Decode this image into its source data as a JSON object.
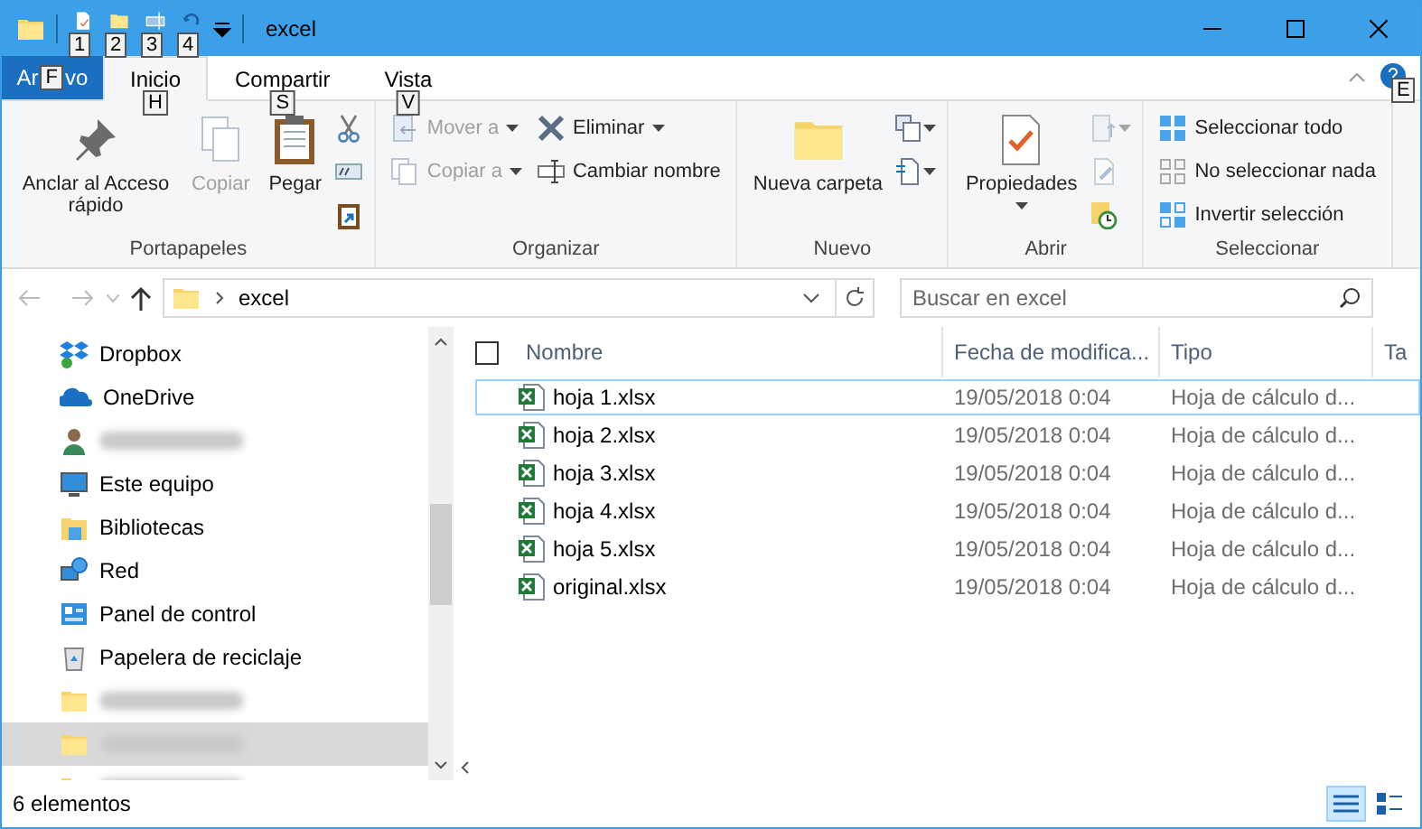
{
  "window": {
    "title": "excel"
  },
  "quick_access": [
    {
      "keytip": "1"
    },
    {
      "keytip": "2"
    },
    {
      "keytip": "3"
    },
    {
      "keytip": "4"
    }
  ],
  "ribbon_tabs": [
    {
      "kind": "file",
      "label_parts": [
        "Ar",
        "vo"
      ],
      "keytip": "F",
      "selected": false
    },
    {
      "kind": "tab",
      "label": "Inicio",
      "keytip": "H",
      "selected": true
    },
    {
      "kind": "tab",
      "label": "Compartir",
      "keytip": "S",
      "selected": false
    },
    {
      "kind": "tab",
      "label": "Vista",
      "keytip": "V",
      "selected": false
    }
  ],
  "help_keytip": "E",
  "ribbon_groups": [
    {
      "label": "Portapapeles",
      "columns": [
        [
          {
            "kind": "large",
            "label": "Anclar al Acceso rápido",
            "disabled": false
          }
        ],
        [
          {
            "kind": "large",
            "label": "Copiar",
            "disabled": true
          }
        ],
        [
          {
            "kind": "large",
            "label": "Pegar",
            "disabled": false
          }
        ],
        [
          {
            "kind": "icon",
            "disabled": false
          },
          {
            "kind": "icon",
            "disabled": false
          },
          {
            "kind": "icon",
            "disabled": false
          }
        ]
      ]
    },
    {
      "label": "Organizar",
      "columns": [
        [
          {
            "kind": "small",
            "label": "Mover a",
            "dropdown": true,
            "disabled": true
          },
          {
            "kind": "small",
            "label": "Copiar a",
            "dropdown": true,
            "disabled": true
          }
        ],
        [
          {
            "kind": "small",
            "label": "Eliminar",
            "dropdown": true,
            "disabled": false
          },
          {
            "kind": "small",
            "label": "Cambiar nombre",
            "dropdown": false,
            "disabled": false
          }
        ]
      ]
    },
    {
      "label": "Nuevo",
      "columns": [
        [
          {
            "kind": "large",
            "label": "Nueva carpeta",
            "disabled": false
          }
        ],
        [
          {
            "kind": "icon",
            "dropdown": true,
            "disabled": false
          },
          {
            "kind": "icon",
            "dropdown": true,
            "disabled": false
          }
        ]
      ]
    },
    {
      "label": "Abrir",
      "columns": [
        [
          {
            "kind": "large",
            "label": "Propiedades",
            "dropdown": true,
            "disabled": false
          }
        ],
        [
          {
            "kind": "icon",
            "dropdown": true,
            "disabled": true
          },
          {
            "kind": "icon",
            "disabled": true
          },
          {
            "kind": "icon",
            "disabled": false
          }
        ]
      ]
    },
    {
      "label": "Seleccionar",
      "columns": [
        [
          {
            "kind": "small",
            "label": "Seleccionar todo",
            "disabled": false
          },
          {
            "kind": "small",
            "label": "No seleccionar nada",
            "disabled": false
          },
          {
            "kind": "small",
            "label": "Invertir selección",
            "disabled": false
          }
        ]
      ]
    }
  ],
  "address": {
    "path": "excel"
  },
  "search": {
    "placeholder": "Buscar en excel"
  },
  "nav_items": [
    {
      "kind": "dropbox",
      "label": "Dropbox",
      "selected": false
    },
    {
      "kind": "onedrive",
      "label": "OneDrive",
      "selected": false
    },
    {
      "kind": "user",
      "blurred": true,
      "selected": false
    },
    {
      "kind": "pc",
      "label": "Este equipo",
      "selected": false
    },
    {
      "kind": "libraries",
      "label": "Bibliotecas",
      "selected": false
    },
    {
      "kind": "network",
      "label": "Red",
      "selected": false
    },
    {
      "kind": "control",
      "label": "Panel de control",
      "selected": false
    },
    {
      "kind": "recycle",
      "label": "Papelera de reciclaje",
      "selected": false
    },
    {
      "kind": "folder",
      "blurred": true,
      "selected": false
    },
    {
      "kind": "folder",
      "blurred": true,
      "selected": true
    },
    {
      "kind": "folder",
      "blurred": true,
      "selected": false
    }
  ],
  "select_all": {
    "checked": false
  },
  "columns": [
    "Nombre",
    "Fecha de modifica...",
    "Tipo",
    "Ta"
  ],
  "files": [
    {
      "name": "hoja 1.xlsx",
      "date": "19/05/2018 0:04",
      "type": "Hoja de cálculo d...",
      "focused": true
    },
    {
      "name": "hoja 2.xlsx",
      "date": "19/05/2018 0:04",
      "type": "Hoja de cálculo d...",
      "focused": false
    },
    {
      "name": "hoja 3.xlsx",
      "date": "19/05/2018 0:04",
      "type": "Hoja de cálculo d...",
      "focused": false
    },
    {
      "name": "hoja 4.xlsx",
      "date": "19/05/2018 0:04",
      "type": "Hoja de cálculo d...",
      "focused": false
    },
    {
      "name": "hoja 5.xlsx",
      "date": "19/05/2018 0:04",
      "type": "Hoja de cálculo d...",
      "focused": false
    },
    {
      "name": "original.xlsx",
      "date": "19/05/2018 0:04",
      "type": "Hoja de cálculo d...",
      "focused": false
    }
  ],
  "status_bar": {
    "count": "6 elementos",
    "views": [
      {
        "kind": "details",
        "selected": true
      },
      {
        "kind": "tiles",
        "selected": false
      }
    ]
  }
}
